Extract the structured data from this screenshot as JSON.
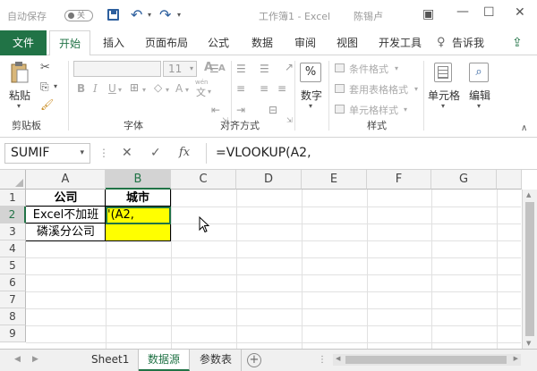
{
  "titlebar": {
    "autosave_label": "自动保存",
    "autosave_state": "关",
    "title": "工作簿1 - Excel",
    "user": "陈锡卢",
    "undo_icon": "undo-icon",
    "redo_icon": "redo-icon",
    "customize_icon": "chevron-down-icon"
  },
  "ribbon_tabs": {
    "file": "文件",
    "items": [
      "开始",
      "插入",
      "页面布局",
      "公式",
      "数据",
      "审阅",
      "视图",
      "开发工具"
    ],
    "tell_me": "告诉我",
    "share_icon": "share-icon"
  },
  "ribbon": {
    "clipboard": {
      "paste": "粘贴",
      "label": "剪贴板"
    },
    "font": {
      "size": "11",
      "bold": "B",
      "italic": "I",
      "underline": "U",
      "label": "字体",
      "fontsize_big": "A",
      "fontsize_small": "A",
      "phonetic": "wén"
    },
    "alignment": {
      "label": "对齐方式"
    },
    "number": {
      "label": "数字",
      "icon": "%"
    },
    "styles": {
      "conditional": "条件格式",
      "table": "套用表格格式",
      "cell": "单元格样式",
      "label": "样式"
    },
    "cells": {
      "label": "单元格"
    },
    "editing": {
      "label": "编辑"
    }
  },
  "formula_bar": {
    "name_box": "SUMIF",
    "cancel": "✕",
    "enter": "✓",
    "fx": "fx",
    "formula": "=VLOOKUP(A2,"
  },
  "grid": {
    "columns": [
      "A",
      "B",
      "C",
      "D",
      "E",
      "F",
      "G"
    ],
    "rows": [
      "1",
      "2",
      "3",
      "4",
      "5",
      "6",
      "7",
      "8",
      "9"
    ],
    "cells": {
      "A1": "公司",
      "B1": "城市",
      "A2": "Excel不加班",
      "B2": "'(A2,",
      "A3": "磷溪分公司"
    },
    "active_cell": "B2",
    "highlight_color": "#FFFF00"
  },
  "sheets": {
    "tabs": [
      "Sheet1",
      "数据源",
      "参数表"
    ],
    "active": "数据源",
    "add": "+"
  },
  "colors": {
    "accent": "#217346"
  }
}
